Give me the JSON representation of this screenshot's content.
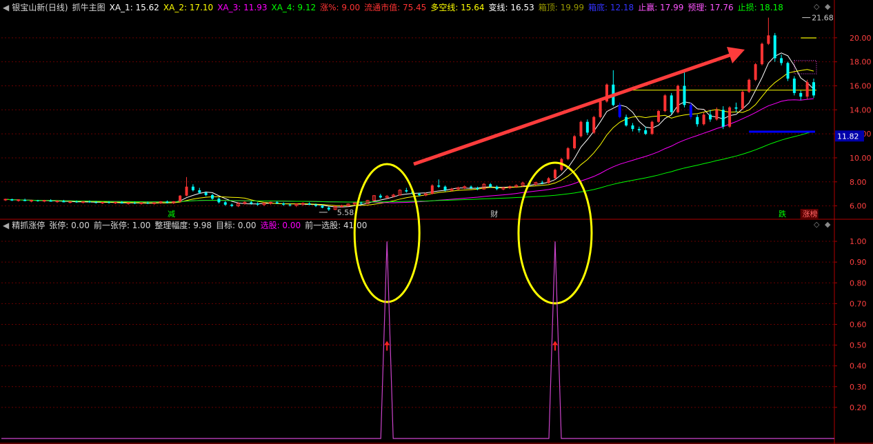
{
  "header_top": {
    "items": [
      {
        "text": "银宝山新(日线)",
        "color": "#d8d8d8"
      },
      {
        "text": "抓牛主图",
        "color": "#d8d8d8"
      },
      {
        "text": "XA_1: 15.62",
        "color": "#ffffff"
      },
      {
        "text": "XA_2: 17.10",
        "color": "#ffff00"
      },
      {
        "text": "XA_3: 11.93",
        "color": "#ff00ff"
      },
      {
        "text": "XA_4: 9.12",
        "color": "#00ff00"
      },
      {
        "text": "涨%: 9.00",
        "color": "#ff3333"
      },
      {
        "text": "流通市值: 75.45",
        "color": "#ff3333"
      },
      {
        "text": "多空线: 15.64",
        "color": "#ffff00"
      },
      {
        "text": "变线: 16.53",
        "color": "#ffffff"
      },
      {
        "text": "箱顶: 19.99",
        "color": "#999900"
      },
      {
        "text": "箱底: 12.18",
        "color": "#3333ff"
      },
      {
        "text": "止赢: 17.99",
        "color": "#ff55ff"
      },
      {
        "text": "预理: 17.76",
        "color": "#ff55ff"
      },
      {
        "text": "止损: 18.18",
        "color": "#00ff00"
      }
    ]
  },
  "header_bottom": {
    "items": [
      {
        "text": "精抓涨停",
        "color": "#d8d8d8"
      },
      {
        "text": "张停: 0.00",
        "color": "#d8d8d8"
      },
      {
        "text": "前一张停: 1.00",
        "color": "#d8d8d8"
      },
      {
        "text": "整理幅度: 9.98",
        "color": "#d8d8d8"
      },
      {
        "text": "目标: 0.00",
        "color": "#d8d8d8"
      },
      {
        "text": "选股: 0.00",
        "color": "#ff00ff"
      },
      {
        "text": "前一选股: 41.00",
        "color": "#d8d8d8"
      }
    ]
  },
  "controls": {
    "diamond": "◇",
    "diamond_filled": "◆"
  },
  "annotations": {
    "high_label": "21.68",
    "low_label": "5.58",
    "last_price_tag": "11.82",
    "signal_jian": "减",
    "signal_cai": "财",
    "signal_die": "跌",
    "signal_zhangbang": "涨榜"
  },
  "colors": {
    "up": "#ff3333",
    "down": "#00ffff",
    "boxbottom": "#0000ff",
    "ellipse": "#ffff00",
    "arrow": "#ff3c3c",
    "grid": "#6a0000",
    "axis": "#b00000",
    "ind_line": "#cc44cc"
  },
  "chart_data": [
    {
      "type": "candlestick",
      "title": "银宝山新(日线)",
      "ylim": [
        5.0,
        22.0
      ],
      "yticks": [
        "20.00",
        "18.00",
        "16.00",
        "14.00",
        "12.00",
        "10.00",
        "8.00",
        "6.00"
      ],
      "ytick_values": [
        20,
        18,
        16,
        14,
        12,
        10,
        8,
        6
      ],
      "grid": true,
      "candles": [
        [
          6.5,
          6.6,
          6.4,
          6.55
        ],
        [
          6.55,
          6.6,
          6.4,
          6.45
        ],
        [
          6.45,
          6.55,
          6.35,
          6.5
        ],
        [
          6.5,
          6.6,
          6.4,
          6.4
        ],
        [
          6.4,
          6.5,
          6.3,
          6.45
        ],
        [
          6.45,
          6.5,
          6.35,
          6.4
        ],
        [
          6.4,
          6.5,
          6.3,
          6.45
        ],
        [
          6.45,
          6.55,
          6.35,
          6.35
        ],
        [
          6.35,
          6.45,
          6.25,
          6.4
        ],
        [
          6.4,
          6.5,
          6.3,
          6.3
        ],
        [
          6.3,
          6.4,
          6.2,
          6.35
        ],
        [
          6.35,
          6.45,
          6.25,
          6.3
        ],
        [
          6.3,
          6.4,
          6.2,
          6.35
        ],
        [
          6.35,
          6.45,
          6.25,
          6.3
        ],
        [
          6.3,
          6.4,
          6.2,
          6.25
        ],
        [
          6.25,
          6.35,
          6.15,
          6.3
        ],
        [
          6.3,
          6.4,
          6.2,
          6.25
        ],
        [
          6.25,
          6.35,
          6.15,
          6.3
        ],
        [
          6.3,
          6.4,
          6.2,
          6.2
        ],
        [
          6.2,
          6.3,
          6.1,
          6.25
        ],
        [
          6.25,
          6.35,
          6.15,
          6.2
        ],
        [
          6.2,
          6.3,
          6.1,
          6.25
        ],
        [
          6.25,
          6.35,
          6.15,
          6.2
        ],
        [
          6.2,
          6.3,
          6.1,
          6.25
        ],
        [
          6.25,
          6.4,
          6.15,
          6.35
        ],
        [
          6.35,
          6.45,
          6.2,
          6.25
        ],
        [
          6.25,
          6.4,
          6.15,
          6.35
        ],
        [
          6.35,
          6.9,
          6.3,
          6.85
        ],
        [
          6.85,
          8.4,
          6.8,
          7.6
        ],
        [
          7.6,
          7.8,
          7.2,
          7.3
        ],
        [
          7.3,
          7.5,
          7.0,
          7.1
        ],
        [
          7.1,
          7.2,
          6.8,
          6.9
        ],
        [
          6.9,
          7.0,
          6.5,
          6.6
        ],
        [
          6.6,
          6.7,
          6.2,
          6.3
        ],
        [
          6.3,
          6.4,
          6.0,
          6.1
        ],
        [
          6.1,
          6.2,
          5.9,
          6.0
        ],
        [
          6.0,
          6.3,
          5.9,
          6.2
        ],
        [
          6.2,
          6.4,
          6.1,
          6.3
        ],
        [
          6.3,
          6.4,
          6.1,
          6.2
        ],
        [
          6.2,
          6.3,
          6.0,
          6.1
        ],
        [
          6.1,
          6.3,
          6.0,
          6.2
        ],
        [
          6.2,
          6.35,
          6.1,
          6.3
        ],
        [
          6.3,
          6.4,
          6.15,
          6.2
        ],
        [
          6.2,
          6.3,
          6.0,
          6.1
        ],
        [
          6.1,
          6.2,
          5.95,
          6.05
        ],
        [
          6.05,
          6.2,
          5.9,
          6.15
        ],
        [
          6.15,
          6.3,
          6.0,
          6.2
        ],
        [
          6.2,
          6.3,
          6.05,
          6.1
        ],
        [
          6.1,
          6.2,
          5.9,
          6.0
        ],
        [
          6.0,
          6.1,
          5.8,
          5.85
        ],
        [
          5.85,
          5.95,
          5.58,
          5.7
        ],
        [
          5.7,
          6.0,
          5.65,
          5.95
        ],
        [
          5.95,
          6.1,
          5.85,
          6.0
        ],
        [
          6.0,
          6.2,
          5.95,
          6.15
        ],
        [
          6.15,
          6.3,
          6.05,
          6.25
        ],
        [
          6.25,
          6.35,
          6.1,
          6.2
        ],
        [
          6.2,
          6.5,
          6.15,
          6.45
        ],
        [
          6.45,
          6.9,
          6.4,
          6.85
        ],
        [
          6.85,
          7.0,
          6.6,
          6.7
        ],
        [
          6.7,
          6.9,
          6.6,
          6.8
        ],
        [
          6.8,
          7.0,
          6.7,
          6.9
        ],
        [
          6.9,
          7.4,
          6.85,
          7.3
        ],
        [
          7.3,
          7.5,
          7.1,
          7.2
        ],
        [
          7.2,
          7.3,
          6.9,
          7.0
        ],
        [
          7.0,
          7.1,
          6.8,
          6.9
        ],
        [
          6.9,
          7.1,
          6.8,
          7.0
        ],
        [
          7.0,
          7.8,
          6.95,
          7.7
        ],
        [
          7.7,
          8.2,
          7.5,
          7.6
        ],
        [
          7.6,
          7.7,
          7.2,
          7.3
        ],
        [
          7.3,
          7.5,
          7.2,
          7.4
        ],
        [
          7.4,
          7.6,
          7.3,
          7.5
        ],
        [
          7.5,
          7.7,
          7.4,
          7.6
        ],
        [
          7.6,
          7.7,
          7.4,
          7.5
        ],
        [
          7.5,
          7.6,
          7.3,
          7.4
        ],
        [
          7.4,
          7.9,
          7.35,
          7.8
        ],
        [
          7.8,
          7.9,
          7.5,
          7.6
        ],
        [
          7.6,
          7.7,
          7.3,
          7.4
        ],
        [
          7.4,
          7.6,
          7.3,
          7.5
        ],
        [
          7.5,
          7.7,
          7.4,
          7.6
        ],
        [
          7.6,
          7.8,
          7.5,
          7.7
        ],
        [
          7.7,
          8.0,
          7.6,
          7.9
        ],
        [
          7.9,
          8.1,
          7.7,
          7.8
        ],
        [
          7.8,
          8.0,
          7.7,
          7.95
        ],
        [
          7.95,
          8.1,
          7.8,
          7.9
        ],
        [
          7.9,
          8.4,
          7.85,
          8.3
        ],
        [
          8.3,
          9.1,
          8.2,
          9.0
        ],
        [
          9.0,
          10.0,
          8.9,
          9.9
        ],
        [
          9.9,
          10.9,
          9.8,
          10.8
        ],
        [
          10.8,
          11.9,
          10.7,
          11.8
        ],
        [
          11.8,
          13.1,
          11.7,
          13.0
        ],
        [
          13.0,
          13.2,
          11.9,
          12.1
        ],
        [
          12.1,
          13.5,
          12.0,
          13.4
        ],
        [
          13.4,
          14.8,
          13.3,
          14.7
        ],
        [
          14.7,
          16.2,
          14.6,
          16.1
        ],
        [
          16.1,
          17.3,
          14.3,
          14.4
        ],
        [
          14.4,
          14.6,
          13.3,
          13.4
        ],
        [
          13.4,
          13.6,
          12.6,
          12.7
        ],
        [
          12.7,
          12.9,
          12.2,
          12.4
        ],
        [
          12.4,
          12.6,
          12.1,
          12.3
        ],
        [
          12.3,
          12.6,
          11.9,
          12.0
        ],
        [
          12.0,
          13.1,
          11.9,
          13.0
        ],
        [
          13.0,
          14.0,
          12.9,
          13.9
        ],
        [
          13.9,
          15.3,
          13.8,
          15.2
        ],
        [
          15.2,
          15.4,
          13.6,
          13.8
        ],
        [
          13.8,
          16.1,
          13.7,
          16.0
        ],
        [
          16.0,
          17.3,
          14.2,
          14.4
        ],
        [
          14.4,
          14.6,
          13.2,
          13.4
        ],
        [
          13.4,
          13.6,
          12.6,
          12.8
        ],
        [
          12.8,
          13.8,
          12.7,
          13.6
        ],
        [
          13.6,
          14.0,
          13.0,
          13.2
        ],
        [
          13.2,
          14.2,
          13.1,
          14.0
        ],
        [
          14.0,
          14.3,
          12.4,
          12.6
        ],
        [
          12.6,
          14.3,
          12.5,
          14.2
        ],
        [
          14.2,
          14.6,
          13.8,
          14.1
        ],
        [
          14.1,
          15.6,
          14.0,
          15.5
        ],
        [
          15.5,
          16.6,
          15.4,
          16.5
        ],
        [
          16.5,
          17.9,
          16.4,
          17.8
        ],
        [
          17.8,
          19.6,
          17.7,
          19.5
        ],
        [
          19.5,
          21.68,
          19.4,
          20.2
        ],
        [
          20.2,
          20.4,
          18.0,
          18.3
        ],
        [
          18.3,
          18.6,
          17.7,
          17.9
        ],
        [
          17.9,
          18.0,
          16.4,
          16.6
        ],
        [
          16.6,
          16.8,
          15.2,
          15.4
        ],
        [
          15.4,
          15.6,
          14.8,
          15.1
        ],
        [
          15.1,
          16.5,
          14.9,
          16.3
        ],
        [
          16.3,
          16.6,
          15.0,
          15.2
        ]
      ],
      "ma_series": [
        {
          "name": "XA_1",
          "color": "#ffffff",
          "period": 5
        },
        {
          "name": "XA_2",
          "color": "#ffff00",
          "period": 10
        },
        {
          "name": "XA_3",
          "color": "#ff00ff",
          "period": 30
        },
        {
          "name": "XA_4",
          "color": "#00ff00",
          "period": 60
        }
      ],
      "hlines": [
        {
          "name": "多空线",
          "value": 15.64,
          "color": "#ffff00"
        },
        {
          "name": "箱底",
          "value": 12.18,
          "color": "#0000ff"
        },
        {
          "name": "箱顶",
          "value": 19.99,
          "color": "#999900"
        }
      ]
    },
    {
      "type": "line",
      "title": "精抓涨停",
      "ylim": [
        0.05,
        1.05
      ],
      "yticks": [
        "1.00",
        "0.90",
        "0.80",
        "0.70",
        "0.60",
        "0.50",
        "0.40",
        "0.30",
        "0.20"
      ],
      "ytick_values": [
        1.0,
        0.9,
        0.8,
        0.7,
        0.6,
        0.5,
        0.4,
        0.3,
        0.2
      ],
      "grid": true,
      "series": [
        {
          "name": "选股",
          "color": "#cc44cc",
          "spikes_at_candle": [
            59,
            85
          ],
          "spike_value": 1.0,
          "base_value": 0.05
        }
      ],
      "arrow_value": 0.5
    }
  ]
}
